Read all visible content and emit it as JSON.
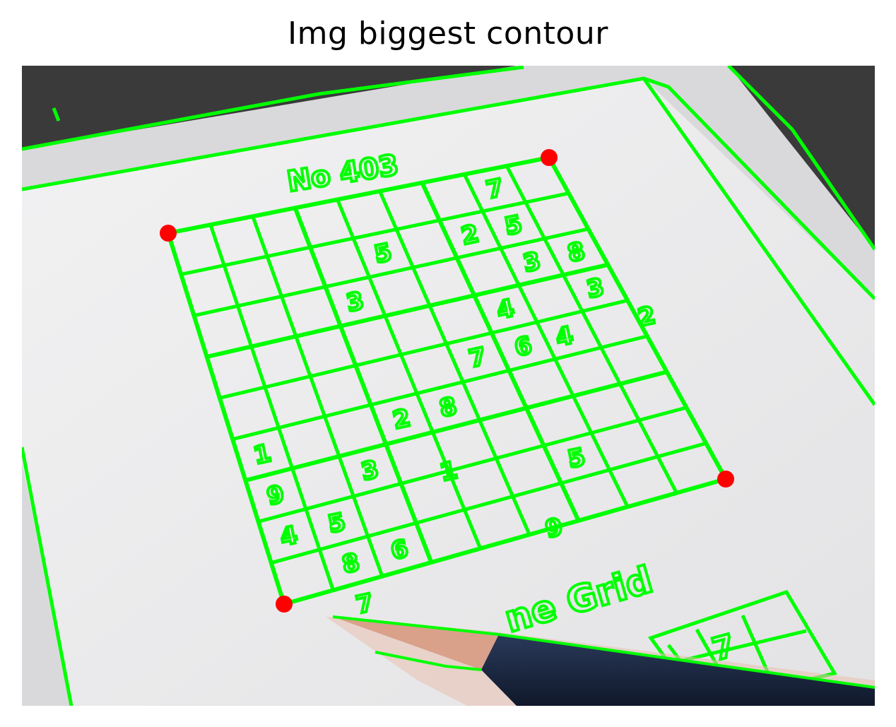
{
  "figure": {
    "title": "Img biggest contour"
  },
  "photo": {
    "header_text": "No 403",
    "footer_text": "ne Grid",
    "grid_digits": [
      {
        "row": 0,
        "col": 7,
        "text": "7"
      },
      {
        "row": 1,
        "col": 4,
        "text": "5"
      },
      {
        "row": 1,
        "col": 6,
        "text": "2"
      },
      {
        "row": 1,
        "col": 7,
        "text": "5"
      },
      {
        "row": 2,
        "col": 3,
        "text": "3"
      },
      {
        "row": 2,
        "col": 7,
        "text": "3"
      },
      {
        "row": 2,
        "col": 8,
        "text": "8"
      },
      {
        "row": 3,
        "col": 6,
        "text": "4"
      },
      {
        "row": 3,
        "col": 8,
        "text": "3"
      },
      {
        "row": 4,
        "col": 5,
        "text": "7"
      },
      {
        "row": 4,
        "col": 6,
        "text": "6"
      },
      {
        "row": 4,
        "col": 6.9,
        "text": "4"
      },
      {
        "row": 4,
        "col": 8.7,
        "text": "2"
      },
      {
        "row": 5,
        "col": 0,
        "text": "1"
      },
      {
        "row": 5,
        "col": 3,
        "text": "2"
      },
      {
        "row": 5,
        "col": 4,
        "text": "8"
      },
      {
        "row": 6,
        "col": 0,
        "text": "9"
      },
      {
        "row": 6,
        "col": 2,
        "text": "3"
      },
      {
        "row": 6.5,
        "col": 3.5,
        "text": "1"
      },
      {
        "row": 7,
        "col": 0,
        "text": "4"
      },
      {
        "row": 7,
        "col": 1,
        "text": "5"
      },
      {
        "row": 7,
        "col": 6,
        "text": "5"
      },
      {
        "row": 8,
        "col": 1,
        "text": "8"
      },
      {
        "row": 8,
        "col": 2,
        "text": "6"
      },
      {
        "row": 8.5,
        "col": 5,
        "text": "9"
      },
      {
        "row": 9,
        "col": 1,
        "text": "7"
      }
    ],
    "second_grid_digit": "7",
    "colors": {
      "contour": "#00ff00",
      "corner_marker": "#ff0000",
      "paper": "#ececed",
      "table": "#3a3a3a",
      "pencil_body": "#1c2a44",
      "pencil_wood": "#d9a08a"
    },
    "corner_count": 4
  }
}
